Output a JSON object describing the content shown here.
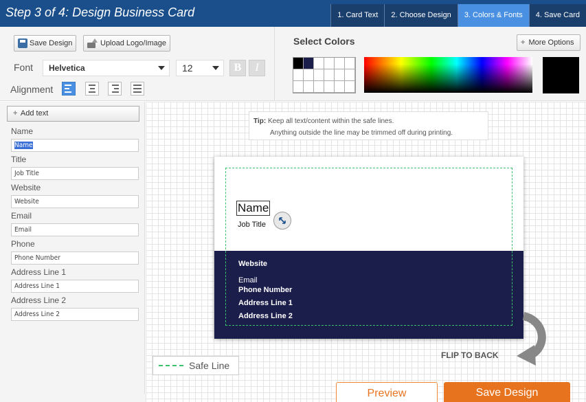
{
  "header": {
    "title": "Step 3 of 4: Design Business Card",
    "steps": [
      "1. Card Text",
      "2. Choose Design",
      "3. Colors & Fonts",
      "4. Save Card"
    ]
  },
  "toolbar": {
    "save_design": "Save Design",
    "upload_logo": "Upload Logo/Image",
    "font_label": "Font",
    "font_value": "Helvetica",
    "size_value": "12",
    "bold": "B",
    "italic": "I",
    "alignment_label": "Alignment",
    "select_colors": "Select Colors",
    "more_options": "More Options"
  },
  "colors": {
    "header_bg": "#1a4f8b",
    "active_step": "#4a90e2",
    "card_dark": "#1b1d4b",
    "safe_line": "#38c36c",
    "accent": "#e8731e",
    "current_color": "#000000",
    "swatches": [
      "#000000",
      "#1b1d4b",
      "#ffffff",
      "#ffffff",
      "#ffffff",
      "#ffffff",
      "#ffffff",
      "#ffffff",
      "#ffffff",
      "#ffffff",
      "#ffffff",
      "#ffffff",
      "#ffffff",
      "#ffffff",
      "#ffffff",
      "#ffffff",
      "#ffffff",
      "#ffffff"
    ]
  },
  "panel": {
    "add_text": "Add text",
    "fields": [
      {
        "label": "Name",
        "value": "Name"
      },
      {
        "label": "Title",
        "value": "Job Title"
      },
      {
        "label": "Website",
        "value": "Website"
      },
      {
        "label": "Email",
        "value": "Email"
      },
      {
        "label": "Phone",
        "value": "Phone Number"
      },
      {
        "label": "Address Line 1",
        "value": "Address Line 1"
      },
      {
        "label": "Address Line 2",
        "value": "Address Line 2"
      }
    ]
  },
  "tip": {
    "label": "Tip:",
    "line1": "Keep all text/content within the safe lines.",
    "line2": "Anything outside the line may be trimmed off during printing."
  },
  "card": {
    "name": "Name",
    "title": "Job Title",
    "website": "Website",
    "email": "Email",
    "phone": "Phone Number",
    "address1": "Address Line 1",
    "address2": "Address Line 2"
  },
  "canvas": {
    "flip": "FLIP TO BACK",
    "safe_line_legend": "Safe Line"
  },
  "actions": {
    "preview": "Preview",
    "save": "Save Design"
  }
}
